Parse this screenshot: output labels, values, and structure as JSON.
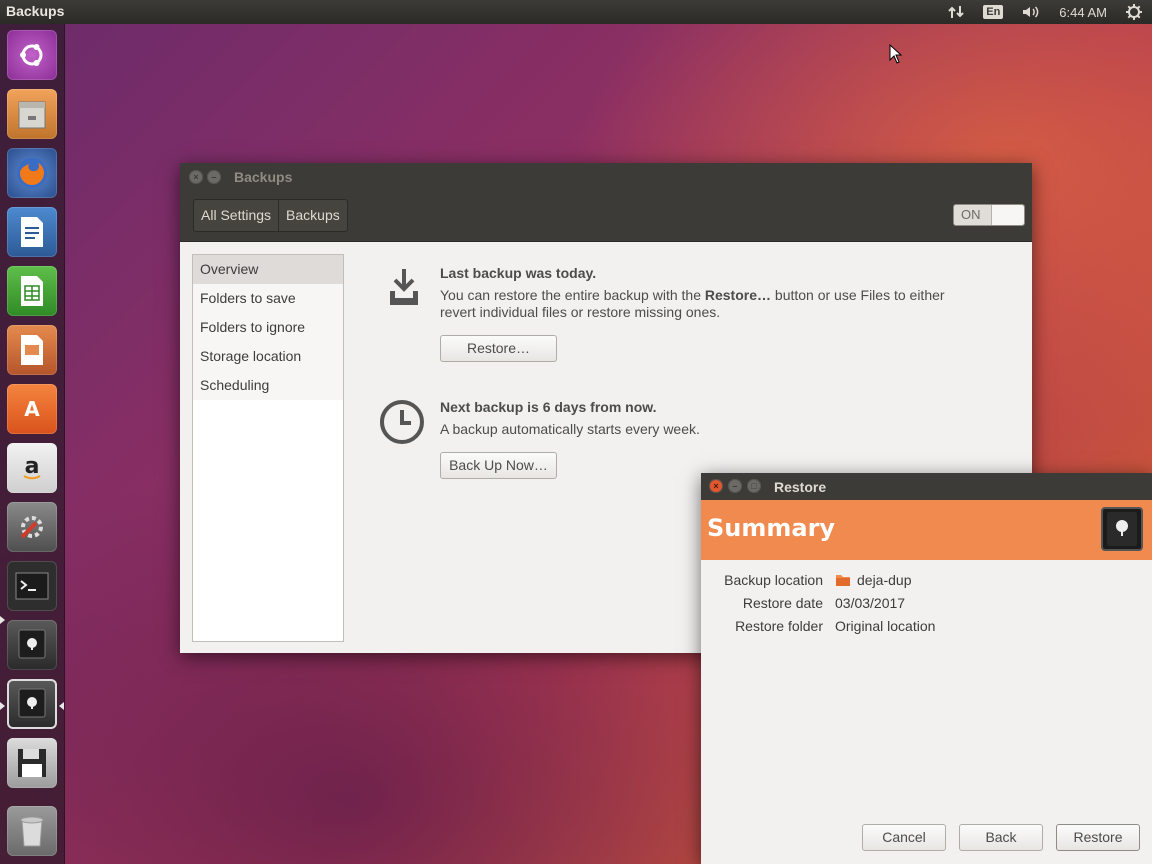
{
  "top_panel": {
    "app_title": "Backups",
    "language": "En",
    "time": "6:44 AM"
  },
  "launcher": {
    "items": [
      {
        "name": "ubuntu-dash",
        "icon": "ubuntu-logo-icon"
      },
      {
        "name": "files",
        "icon": "file-cabinet-icon"
      },
      {
        "name": "firefox",
        "icon": "firefox-icon"
      },
      {
        "name": "libreoffice-writer",
        "icon": "writer-document-icon"
      },
      {
        "name": "libreoffice-calc",
        "icon": "calc-spreadsheet-icon"
      },
      {
        "name": "libreoffice-impress",
        "icon": "impress-presentation-icon"
      },
      {
        "name": "ubuntu-software",
        "icon": "shopping-bag-icon"
      },
      {
        "name": "amazon",
        "icon": "amazon-icon"
      },
      {
        "name": "system-settings",
        "icon": "settings-wrench-icon"
      },
      {
        "name": "terminal",
        "icon": "terminal-icon"
      },
      {
        "name": "deja-dup-1",
        "icon": "safe-icon"
      },
      {
        "name": "deja-dup-2",
        "icon": "safe-icon"
      },
      {
        "name": "floppy",
        "icon": "floppy-disk-icon"
      },
      {
        "name": "trash",
        "icon": "trash-icon"
      }
    ]
  },
  "backups_window": {
    "title": "Backups",
    "breadcrumbs": [
      "All Settings",
      "Backups"
    ],
    "switch_label": "ON",
    "sidebar": [
      "Overview",
      "Folders to save",
      "Folders to ignore",
      "Storage location",
      "Scheduling"
    ],
    "last_backup": {
      "heading": "Last backup was today.",
      "text_before": "You can restore the entire backup with the ",
      "text_bold": "Restore…",
      "text_after": " button or use Files to either revert individual files or restore missing ones.",
      "button": "Restore…"
    },
    "next_backup": {
      "heading": "Next backup is 6 days from now.",
      "text": "A backup automatically starts every week.",
      "button": "Back Up Now…"
    }
  },
  "restore_dialog": {
    "title": "Restore",
    "banner": "Summary",
    "rows": [
      {
        "label": "Backup location",
        "value": "deja-dup"
      },
      {
        "label": "Restore date",
        "value": "03/03/2017"
      },
      {
        "label": "Restore folder",
        "value": "Original location"
      }
    ],
    "buttons": {
      "cancel": "Cancel",
      "back": "Back",
      "restore": "Restore"
    }
  },
  "colors": {
    "banner": "#f08a4f",
    "close_button": "#e4572e",
    "panel": "#3c3b37"
  }
}
